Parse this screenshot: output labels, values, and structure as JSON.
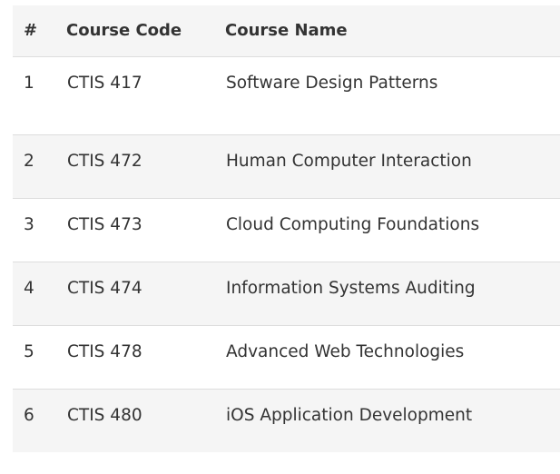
{
  "table": {
    "headers": [
      "#",
      "Course Code",
      "Course Name"
    ],
    "rows": [
      {
        "num": "1",
        "code": "CTIS 417",
        "name": "Software Design Patterns"
      },
      {
        "num": "2",
        "code": "CTIS 472",
        "name": "Human Computer Interaction"
      },
      {
        "num": "3",
        "code": "CTIS 473",
        "name": "Cloud Computing Foundations"
      },
      {
        "num": "4",
        "code": "CTIS 474",
        "name": "Information Systems Auditing"
      },
      {
        "num": "5",
        "code": "CTIS 478",
        "name": "Advanced Web Technologies"
      },
      {
        "num": "6",
        "code": "CTIS 480",
        "name": "iOS Application Development"
      }
    ]
  }
}
